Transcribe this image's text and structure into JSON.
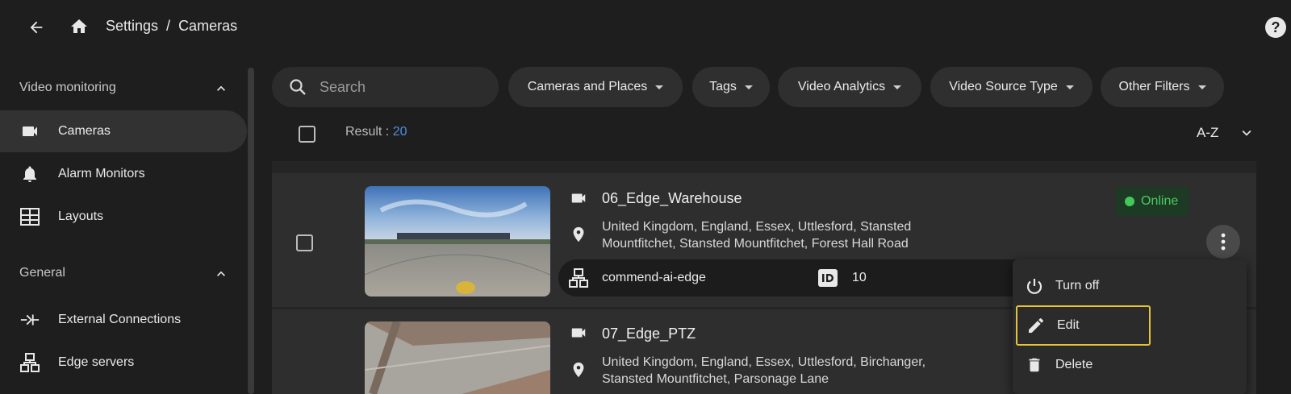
{
  "header": {
    "breadcrumb_root": "Settings",
    "breadcrumb_sep": "/",
    "breadcrumb_current": "Cameras",
    "help_label": "?"
  },
  "sidebar": {
    "sections": [
      {
        "title": "Video monitoring"
      },
      {
        "title": "General"
      }
    ],
    "items": [
      {
        "label": "Cameras",
        "icon": "video-camera-icon",
        "active": true
      },
      {
        "label": "Alarm Monitors",
        "icon": "bell-icon"
      },
      {
        "label": "Layouts",
        "icon": "layout-grid-icon"
      },
      {
        "label": "External Connections",
        "icon": "connection-icon"
      },
      {
        "label": "Edge servers",
        "icon": "edge-server-icon"
      }
    ]
  },
  "toolbar": {
    "search_placeholder": "Search",
    "filters": [
      "Cameras and Places",
      "Tags",
      "Video Analytics",
      "Video Source Type",
      "Other Filters"
    ]
  },
  "results": {
    "label": "Result : ",
    "count": "20",
    "sort": "A-Z"
  },
  "cameras": [
    {
      "name": "06_Edge_Warehouse",
      "address_line1": "United Kingdom, England, Essex, Uttlesford, Stansted",
      "address_line2": "Mountfitchet, Stansted Mountfitchet, Forest Hall Road",
      "server": "commend-ai-edge",
      "id": "10",
      "status": "Online"
    },
    {
      "name": "07_Edge_PTZ",
      "address_line1": "United Kingdom, England, Essex, Uttlesford, Birchanger,",
      "address_line2": "Stansted Mountfitchet, Parsonage Lane"
    }
  ],
  "context_menu": {
    "items": [
      "Turn off",
      "Edit",
      "Delete"
    ]
  },
  "colors": {
    "background": "#1e1e1e",
    "accent_blue": "#4f8fe0",
    "online_green": "#43c85a",
    "focus_yellow": "#e5c23a"
  }
}
